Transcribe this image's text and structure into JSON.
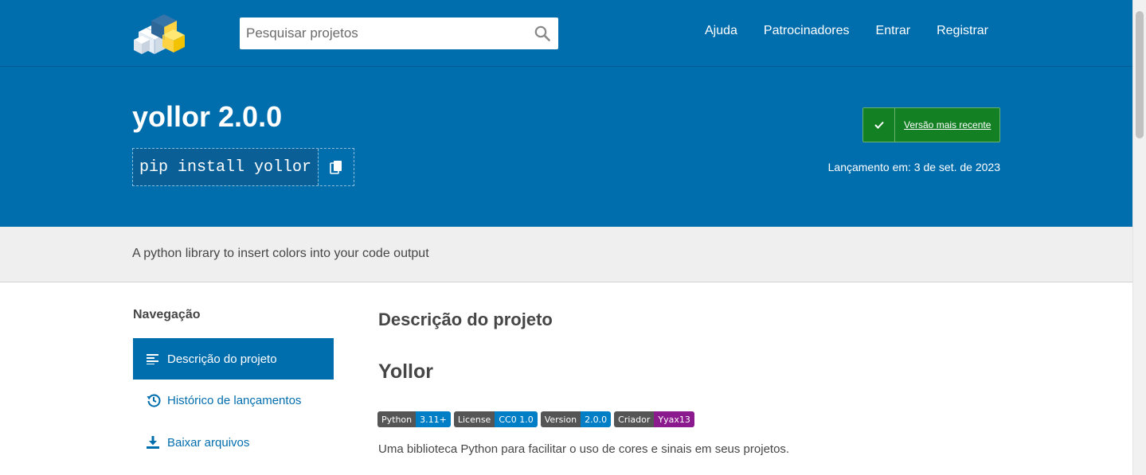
{
  "header": {
    "search_placeholder": "Pesquisar projetos",
    "nav": [
      "Ajuda",
      "Patrocinadores",
      "Entrar",
      "Registrar"
    ]
  },
  "package": {
    "title": "yollor 2.0.0",
    "pip_command": "pip install yollor",
    "latest_label": "Versão mais recente",
    "release_text": "Lançamento em: 3 de set. de 2023",
    "summary": "A python library to insert colors into your code output"
  },
  "sidebar": {
    "heading": "Navegação",
    "items": [
      {
        "label": "Descrição do projeto",
        "icon": "align-left-icon"
      },
      {
        "label": "Histórico de lançamentos",
        "icon": "history-icon"
      },
      {
        "label": "Baixar arquivos",
        "icon": "download-icon"
      }
    ]
  },
  "main": {
    "section_heading": "Descrição do projeto",
    "readme_heading": "Yollor",
    "badges": [
      {
        "key": "Python",
        "value": "3.11+",
        "color": "#007ec6"
      },
      {
        "key": "License",
        "value": "CC0 1.0",
        "color": "#007ec6"
      },
      {
        "key": "Version",
        "value": "2.0.0",
        "color": "#007ec6"
      },
      {
        "key": "Criador",
        "value": "Yyax13",
        "color": "#8a1a8e"
      }
    ],
    "description": "Uma biblioteca Python para facilitar o uso de cores e sinais em seus projetos."
  },
  "colors": {
    "brand_blue": "#006dad",
    "latest_green": "#148024"
  }
}
